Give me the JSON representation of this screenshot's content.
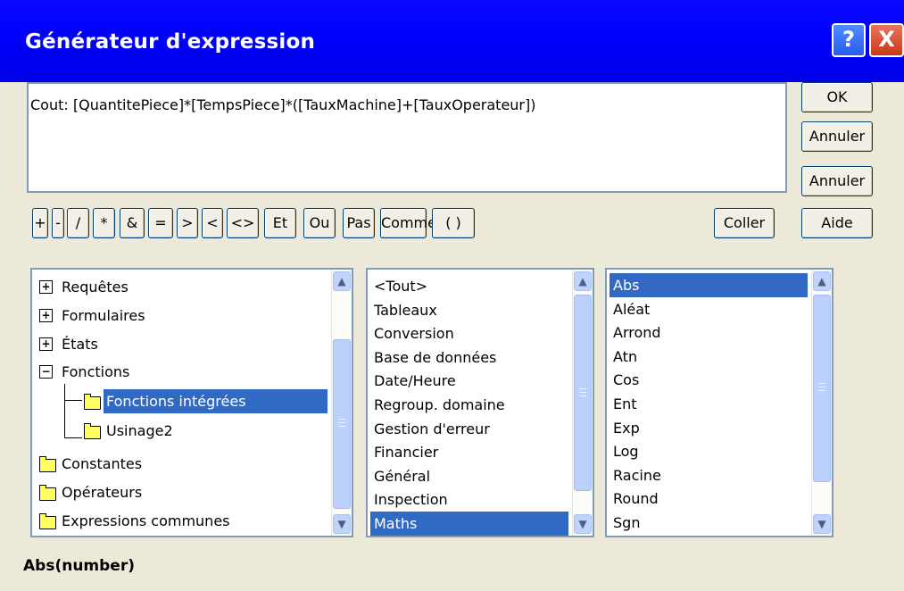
{
  "window": {
    "title": "Générateur d'expression",
    "help_label": "?",
    "close_label": "X"
  },
  "expression": {
    "value": "Cout: [QuantitePiece]*[TempsPiece]*([TauxMachine]+[TauxOperateur])"
  },
  "buttons": {
    "ok": "OK",
    "annuler": "Annuler",
    "undo": "Annuler",
    "coller": "Coller",
    "aide": "Aide"
  },
  "operators": [
    "+",
    "-",
    "/",
    "*",
    "&",
    "=",
    ">",
    "<",
    "<>",
    "Et",
    "Ou",
    "Pas",
    "Comme",
    "( )"
  ],
  "tree": {
    "items": [
      {
        "label": "Requêtes",
        "icon": "plus-box-icon"
      },
      {
        "label": "Formulaires",
        "icon": "plus-box-icon"
      },
      {
        "label": "États",
        "icon": "plus-box-icon"
      },
      {
        "label": "Fonctions",
        "icon": "minus-box-icon"
      },
      {
        "label": "Fonctions intégrées",
        "icon": "open-folder-icon",
        "selected": true
      },
      {
        "label": "Usinage2",
        "icon": "folder-icon"
      },
      {
        "label": "Constantes",
        "icon": "folder-icon"
      },
      {
        "label": "Opérateurs",
        "icon": "folder-icon"
      },
      {
        "label": "Expressions communes",
        "icon": "folder-icon"
      }
    ]
  },
  "categories": {
    "items": [
      "<Tout>",
      "Tableaux",
      "Conversion",
      "Base de données",
      "Date/Heure",
      "Regroup. domaine",
      "Gestion d'erreur",
      "Financier",
      "Général",
      "Inspection",
      "Maths"
    ],
    "selected": "Maths"
  },
  "functions": {
    "items": [
      "Abs",
      "Aléat",
      "Arrond",
      "Atn",
      "Cos",
      "Ent",
      "Exp",
      "Log",
      "Racine",
      "Round",
      "Sgn"
    ],
    "selected": "Abs"
  },
  "status": {
    "syntax": "Abs(number)"
  },
  "colors": {
    "title_bar": "#0000ff",
    "selection": "#316ac5",
    "dialog": "#ece9d8"
  }
}
